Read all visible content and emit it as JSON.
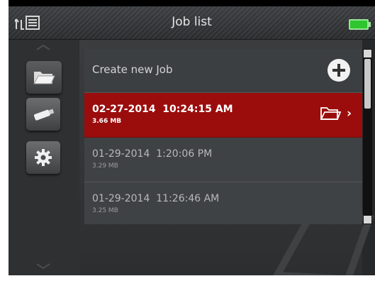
{
  "header": {
    "title": "Job list",
    "icons": [
      "up-arrow-icon",
      "list-icon",
      "battery-icon"
    ],
    "battery_color": "#2fc52f"
  },
  "sidebar": {
    "items": [
      {
        "name": "folder",
        "icon": "folder-icon",
        "active": true
      },
      {
        "name": "usb",
        "icon": "usb-drive-icon",
        "active": false
      },
      {
        "name": "settings",
        "icon": "gear-icon",
        "active": false
      }
    ]
  },
  "job_list": {
    "create_label": "Create new Job",
    "jobs": [
      {
        "date": "02-27-2014  10:24:15 AM",
        "size": "3.66 MB",
        "selected": true
      },
      {
        "date": "01-29-2014  1:20:06 PM",
        "size": "3.29 MB",
        "selected": false
      },
      {
        "date": "01-29-2014  11:26:46 AM",
        "size": "3.25 MB",
        "selected": false
      }
    ],
    "selected_row_arrow": "›"
  },
  "colors": {
    "selected_row": "#9b0d0d",
    "accent_white": "#ffffff",
    "battery": "#2fc52f"
  }
}
